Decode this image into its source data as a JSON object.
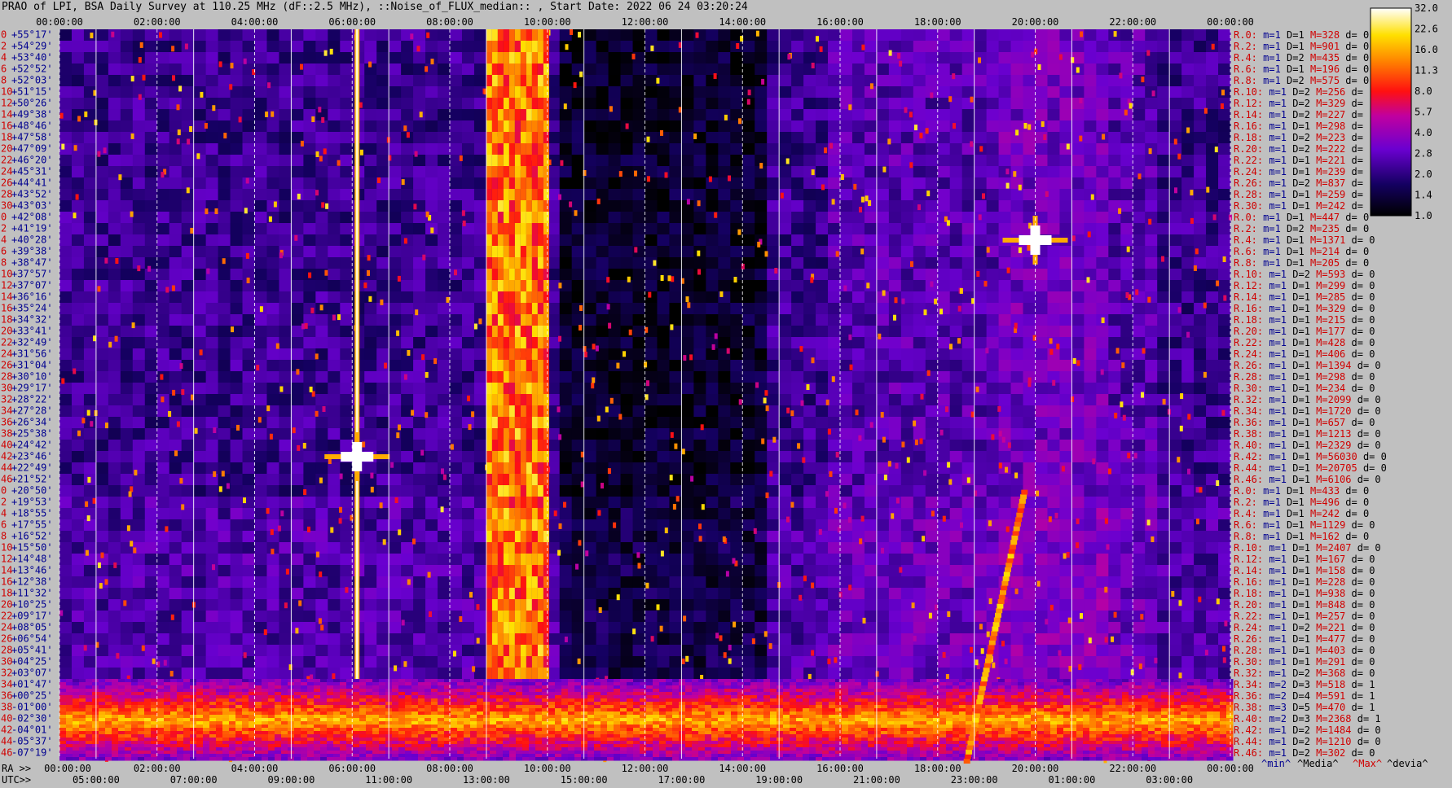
{
  "title": "PRAO of LPI, BSA Daily Survey at 110.25 MHz (dF::2.5 MHz), ::Noise_of_FLUX_median:: , Start Date: 2022 06 24 03:20:24",
  "chart_data": {
    "type": "heatmap",
    "colormap": "gnuplot-heat (black-blue-purple-red-orange-yellow-white)",
    "top_axis_labels": [
      "00:00:00",
      "02:00:00",
      "04:00:00",
      "06:00:00",
      "08:00:00",
      "10:00:00",
      "12:00:00",
      "14:00:00",
      "16:00:00",
      "18:00:00",
      "20:00:00",
      "22:00:00",
      "00:00:00"
    ],
    "bottom_ra_prefix": "RA >>",
    "bottom_ra_labels": [
      "00:00:00",
      "02:00:00",
      "04:00:00",
      "06:00:00",
      "08:00:00",
      "10:00:00",
      "12:00:00",
      "14:00:00",
      "16:00:00",
      "18:00:00",
      "20:00:00",
      "22:00:00",
      "00:00:00"
    ],
    "bottom_utc_prefix": "UTC>>",
    "bottom_utc_labels": [
      "05:00:00",
      "07:00:00",
      "09:00:00",
      "11:00:00",
      "13:00:00",
      "15:00:00",
      "17:00:00",
      "19:00:00",
      "21:00:00",
      "23:00:00",
      "01:00:00",
      "03:00:00"
    ],
    "colorbar_ticks": [
      "32.0",
      "22.6",
      "16.0",
      "11.3",
      "8.0",
      "5.7",
      "4.0",
      "2.8",
      "2.0",
      "1.4",
      "1.0"
    ],
    "dec_labels": [
      "+55°17'",
      "+54°29'",
      "+53°40'",
      "+52°52'",
      "+52°03'",
      "+51°15'",
      "+50°26'",
      "+49°38'",
      "+48°46'",
      "+47°58'",
      "+47°09'",
      "+46°20'",
      "+45°31'",
      "+44°41'",
      "+43°52'",
      "+43°03'",
      "+42°08'",
      "+41°19'",
      "+40°28'",
      "+39°38'",
      "+38°47'",
      "+37°57'",
      "+37°07'",
      "+36°16'",
      "+35°24'",
      "+34°32'",
      "+33°41'",
      "+32°49'",
      "+31°56'",
      "+31°04'",
      "+30°10'",
      "+29°17'",
      "+28°22'",
      "+27°28'",
      "+26°34'",
      "+25°38'",
      "+24°42'",
      "+23°46'",
      "+22°49'",
      "+21°52'",
      "+20°50'",
      "+19°53'",
      "+18°55'",
      "+17°55'",
      "+16°52'",
      "+15°50'",
      "+14°48'",
      "+13°46'",
      "+12°38'",
      "+11°32'",
      "+10°25'",
      "+09°17'",
      "+08°05'",
      "+06°54'",
      "+05°41'",
      "+04°25'",
      "+03°07'",
      "+01°47'",
      "+00°25'",
      "-01°00'",
      "-02°30'",
      "-04°01'",
      "-05°37'",
      "-07°19'"
    ],
    "row_index_labels": [
      "0",
      "2",
      "4",
      "6",
      "8",
      "10",
      "12",
      "14",
      "16",
      "18",
      "20",
      "22",
      "24",
      "26",
      "28",
      "30",
      "0",
      "2",
      "4",
      "6",
      "8",
      "10",
      "12",
      "14",
      "16",
      "18",
      "20",
      "22",
      "24",
      "26",
      "28",
      "30",
      "32",
      "34",
      "36",
      "38",
      "40",
      "42",
      "44",
      "46",
      "0",
      "2",
      "4",
      "6",
      "8",
      "10",
      "12",
      "14",
      "16",
      "18",
      "20",
      "22",
      "24",
      "26",
      "28",
      "30",
      "32",
      "34",
      "36",
      "38",
      "40",
      "42",
      "44",
      "46"
    ],
    "beam_stats": [
      {
        "r": "R.0:",
        "m": "1",
        "d": "1",
        "M": "328",
        "dv": "0"
      },
      {
        "r": "R.2:",
        "m": "1",
        "d": "1",
        "M": "901",
        "dv": "0"
      },
      {
        "r": "R.4:",
        "m": "1",
        "d": "2",
        "M": "435",
        "dv": "0"
      },
      {
        "r": "R.6:",
        "m": "1",
        "d": "1",
        "M": "196",
        "dv": "0"
      },
      {
        "r": "R.8:",
        "m": "1",
        "d": "2",
        "M": "575",
        "dv": "0"
      },
      {
        "r": "R.10:",
        "m": "1",
        "d": "2",
        "M": "256",
        "dv": ""
      },
      {
        "r": "R.12:",
        "m": "1",
        "d": "2",
        "M": "329",
        "dv": ""
      },
      {
        "r": "R.14:",
        "m": "1",
        "d": "2",
        "M": "227",
        "dv": ""
      },
      {
        "r": "R.16:",
        "m": "1",
        "d": "1",
        "M": "298",
        "dv": ""
      },
      {
        "r": "R.18:",
        "m": "1",
        "d": "2",
        "M": "223",
        "dv": ""
      },
      {
        "r": "R.20:",
        "m": "1",
        "d": "2",
        "M": "222",
        "dv": ""
      },
      {
        "r": "R.22:",
        "m": "1",
        "d": "1",
        "M": "221",
        "dv": ""
      },
      {
        "r": "R.24:",
        "m": "1",
        "d": "1",
        "M": "239",
        "dv": ""
      },
      {
        "r": "R.26:",
        "m": "1",
        "d": "2",
        "M": "837",
        "dv": ""
      },
      {
        "r": "R.28:",
        "m": "1",
        "d": "1",
        "M": "259",
        "dv": ""
      },
      {
        "r": "R.30:",
        "m": "1",
        "d": "1",
        "M": "242",
        "dv": ""
      },
      {
        "r": "R.0:",
        "m": "1",
        "d": "1",
        "M": "447",
        "dv": "0"
      },
      {
        "r": "R.2:",
        "m": "1",
        "d": "2",
        "M": "235",
        "dv": "0"
      },
      {
        "r": "R.4:",
        "m": "1",
        "d": "1",
        "M": "1371",
        "dv": "0"
      },
      {
        "r": "R.6:",
        "m": "1",
        "d": "1",
        "M": "214",
        "dv": "0"
      },
      {
        "r": "R.8:",
        "m": "1",
        "d": "1",
        "M": "205",
        "dv": "0"
      },
      {
        "r": "R.10:",
        "m": "1",
        "d": "2",
        "M": "593",
        "dv": "0"
      },
      {
        "r": "R.12:",
        "m": "1",
        "d": "1",
        "M": "299",
        "dv": "0"
      },
      {
        "r": "R.14:",
        "m": "1",
        "d": "1",
        "M": "285",
        "dv": "0"
      },
      {
        "r": "R.16:",
        "m": "1",
        "d": "1",
        "M": "329",
        "dv": "0"
      },
      {
        "r": "R.18:",
        "m": "1",
        "d": "1",
        "M": "215",
        "dv": "0"
      },
      {
        "r": "R.20:",
        "m": "1",
        "d": "1",
        "M": "177",
        "dv": "0"
      },
      {
        "r": "R.22:",
        "m": "1",
        "d": "1",
        "M": "428",
        "dv": "0"
      },
      {
        "r": "R.24:",
        "m": "1",
        "d": "1",
        "M": "406",
        "dv": "0"
      },
      {
        "r": "R.26:",
        "m": "1",
        "d": "1",
        "M": "1394",
        "dv": "0"
      },
      {
        "r": "R.28:",
        "m": "1",
        "d": "1",
        "M": "298",
        "dv": "0"
      },
      {
        "r": "R.30:",
        "m": "1",
        "d": "1",
        "M": "234",
        "dv": "0"
      },
      {
        "r": "R.32:",
        "m": "1",
        "d": "1",
        "M": "2099",
        "dv": "0"
      },
      {
        "r": "R.34:",
        "m": "1",
        "d": "1",
        "M": "1720",
        "dv": "0"
      },
      {
        "r": "R.36:",
        "m": "1",
        "d": "1",
        "M": "657",
        "dv": "0"
      },
      {
        "r": "R.38:",
        "m": "1",
        "d": "1",
        "M": "1213",
        "dv": "0"
      },
      {
        "r": "R.40:",
        "m": "1",
        "d": "1",
        "M": "2329",
        "dv": "0"
      },
      {
        "r": "R.42:",
        "m": "1",
        "d": "1",
        "M": "56030",
        "dv": "0"
      },
      {
        "r": "R.44:",
        "m": "1",
        "d": "1",
        "M": "20705",
        "dv": "0"
      },
      {
        "r": "R.46:",
        "m": "1",
        "d": "1",
        "M": "6106",
        "dv": "0"
      },
      {
        "r": "R.0:",
        "m": "1",
        "d": "1",
        "M": "433",
        "dv": "0"
      },
      {
        "r": "R.2:",
        "m": "1",
        "d": "1",
        "M": "496",
        "dv": "0"
      },
      {
        "r": "R.4:",
        "m": "1",
        "d": "1",
        "M": "242",
        "dv": "0"
      },
      {
        "r": "R.6:",
        "m": "1",
        "d": "1",
        "M": "1129",
        "dv": "0"
      },
      {
        "r": "R.8:",
        "m": "1",
        "d": "1",
        "M": "162",
        "dv": "0"
      },
      {
        "r": "R.10:",
        "m": "1",
        "d": "1",
        "M": "2407",
        "dv": "0"
      },
      {
        "r": "R.12:",
        "m": "1",
        "d": "1",
        "M": "167",
        "dv": "0"
      },
      {
        "r": "R.14:",
        "m": "1",
        "d": "1",
        "M": "158",
        "dv": "0"
      },
      {
        "r": "R.16:",
        "m": "1",
        "d": "1",
        "M": "228",
        "dv": "0"
      },
      {
        "r": "R.18:",
        "m": "1",
        "d": "1",
        "M": "938",
        "dv": "0"
      },
      {
        "r": "R.20:",
        "m": "1",
        "d": "1",
        "M": "848",
        "dv": "0"
      },
      {
        "r": "R.22:",
        "m": "1",
        "d": "1",
        "M": "257",
        "dv": "0"
      },
      {
        "r": "R.24:",
        "m": "1",
        "d": "2",
        "M": "221",
        "dv": "0"
      },
      {
        "r": "R.26:",
        "m": "1",
        "d": "1",
        "M": "477",
        "dv": "0"
      },
      {
        "r": "R.28:",
        "m": "1",
        "d": "1",
        "M": "403",
        "dv": "0"
      },
      {
        "r": "R.30:",
        "m": "1",
        "d": "1",
        "M": "291",
        "dv": "0"
      },
      {
        "r": "R.32:",
        "m": "1",
        "d": "2",
        "M": "368",
        "dv": "0"
      },
      {
        "r": "R.34:",
        "m": "2",
        "d": "3",
        "M": "518",
        "dv": "1"
      },
      {
        "r": "R.36:",
        "m": "2",
        "d": "4",
        "M": "591",
        "dv": "1"
      },
      {
        "r": "R.38:",
        "m": "3",
        "d": "5",
        "M": "470",
        "dv": "1"
      },
      {
        "r": "R.40:",
        "m": "2",
        "d": "3",
        "M": "2368",
        "dv": "1"
      },
      {
        "r": "R.42:",
        "m": "1",
        "d": "2",
        "M": "1484",
        "dv": "0"
      },
      {
        "r": "R.44:",
        "m": "1",
        "d": "2",
        "M": "1210",
        "dv": "0"
      },
      {
        "r": "R.46:",
        "m": "1",
        "d": "2",
        "M": "302",
        "dv": "0"
      }
    ],
    "stat_legend": [
      "^min^",
      "^Media^",
      "^Max^",
      "^devia^"
    ],
    "features": [
      {
        "kind": "vertical_band",
        "ra_start_h": 8.75,
        "ra_end_h": 10.0,
        "intensity": "high"
      },
      {
        "kind": "vertical_line",
        "ra_h": 6.1,
        "intensity": "very_high"
      },
      {
        "kind": "point_source",
        "ra_h": 6.1,
        "dec_row": 37,
        "intensity": "very_high"
      },
      {
        "kind": "point_source",
        "ra_h": 20.0,
        "dec_row": 18,
        "intensity": "very_high"
      },
      {
        "kind": "horizontal_band",
        "dec_row_start": 57,
        "dec_row_end": 63,
        "intensity": "high"
      },
      {
        "kind": "diagonal_track",
        "ra_start_h": 18.6,
        "dec_row_start": 63,
        "ra_end_h": 19.8,
        "dec_row_end": 40,
        "intensity": "high"
      }
    ]
  }
}
